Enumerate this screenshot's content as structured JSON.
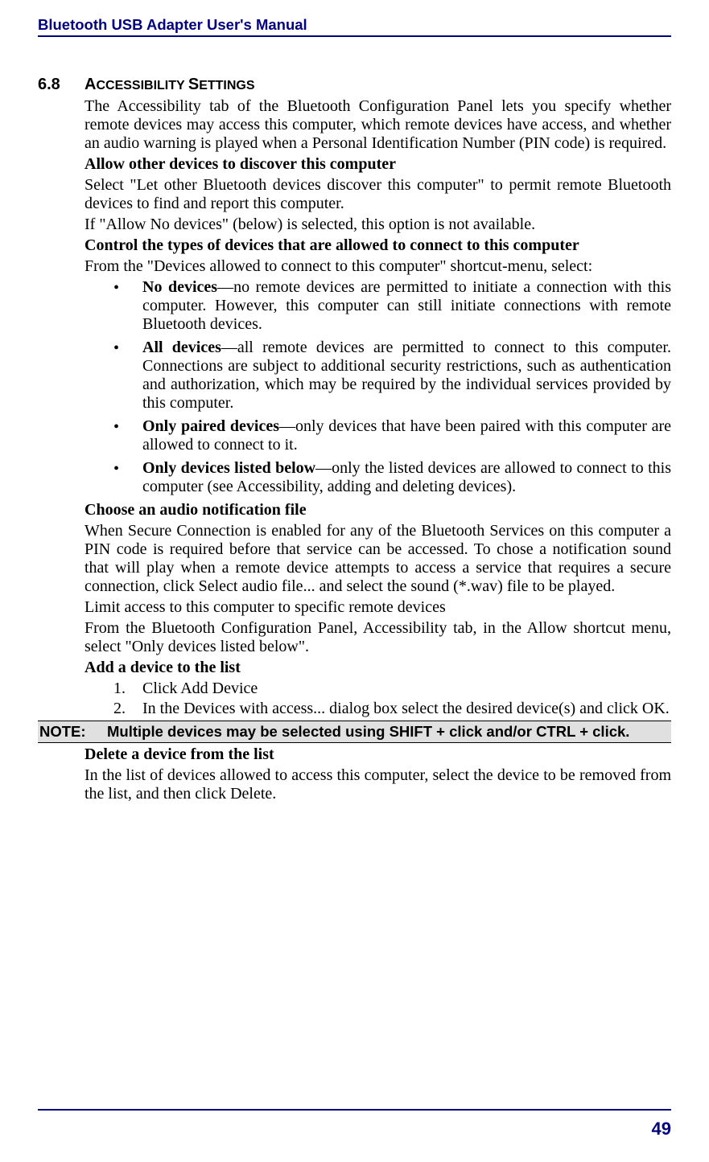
{
  "header": "Bluetooth USB Adapter User's Manual",
  "section": {
    "number": "6.8",
    "title_caps": "A",
    "title_small1": "CCESSIBILITY ",
    "title_caps2": "S",
    "title_small2": "ETTINGS"
  },
  "p1": "The Accessibility tab of the Bluetooth Configuration Panel lets you specify whether remote devices may access this computer, which remote devices have access, and whether an audio warning is played when a Personal Identification Number (PIN code) is required.",
  "h_allow": "Allow other devices to discover this computer",
  "p2": "Select \"Let other Bluetooth devices discover this computer\" to permit remote Bluetooth devices to find and report this computer.",
  "p3": "If \"Allow No devices\" (below) is selected, this option is not available.",
  "h_control": "Control the types of devices that are allowed to connect to this computer",
  "p4": "From the \"Devices allowed to connect to this computer\" shortcut-menu, select:",
  "bullets": {
    "b1_strong": "No devices",
    "b1_rest": "—no remote devices are permitted to initiate a connection with this computer. However, this computer can still initiate connections with remote Bluetooth devices.",
    "b2_strong": "All devices",
    "b2_rest": "—all remote devices are permitted to connect to this computer. Connections are subject to additional security restrictions, such as authentication and authorization, which may be required by the individual services provided by this computer.",
    "b3_strong": "Only paired devices",
    "b3_rest": "—only devices that have been paired with this computer are allowed to connect to it.",
    "b4_strong": "Only devices listed below",
    "b4_rest": "—only the listed devices are allowed to connect to this computer (see Accessibility, adding and deleting devices)."
  },
  "h_audio": "Choose an audio notification file",
  "p5": "When Secure Connection is enabled for any of the Bluetooth Services on this computer a PIN code is required before that service can be accessed. To chose a notification sound that will play when a remote device attempts to access a service that requires a secure connection, click Select audio file... and select the sound (*.wav) file to be played.",
  "p6": "Limit access to this computer to specific remote devices",
  "p7": "From the Bluetooth Configuration Panel, Accessibility tab, in the Allow shortcut menu, select \"Only devices listed below\".",
  "h_add": "Add a device to the list",
  "steps": {
    "s1": "Click Add Device",
    "s2": "In the Devices with access... dialog box select the desired device(s) and click OK."
  },
  "note": {
    "label": "NOTE:",
    "text": "Multiple devices may be selected using SHIFT + click and/or CTRL + click."
  },
  "h_delete": "Delete a device from the list",
  "p8": "In the list of devices allowed to access this computer, select the device to be removed from the list, and then click Delete.",
  "page_number": "49"
}
